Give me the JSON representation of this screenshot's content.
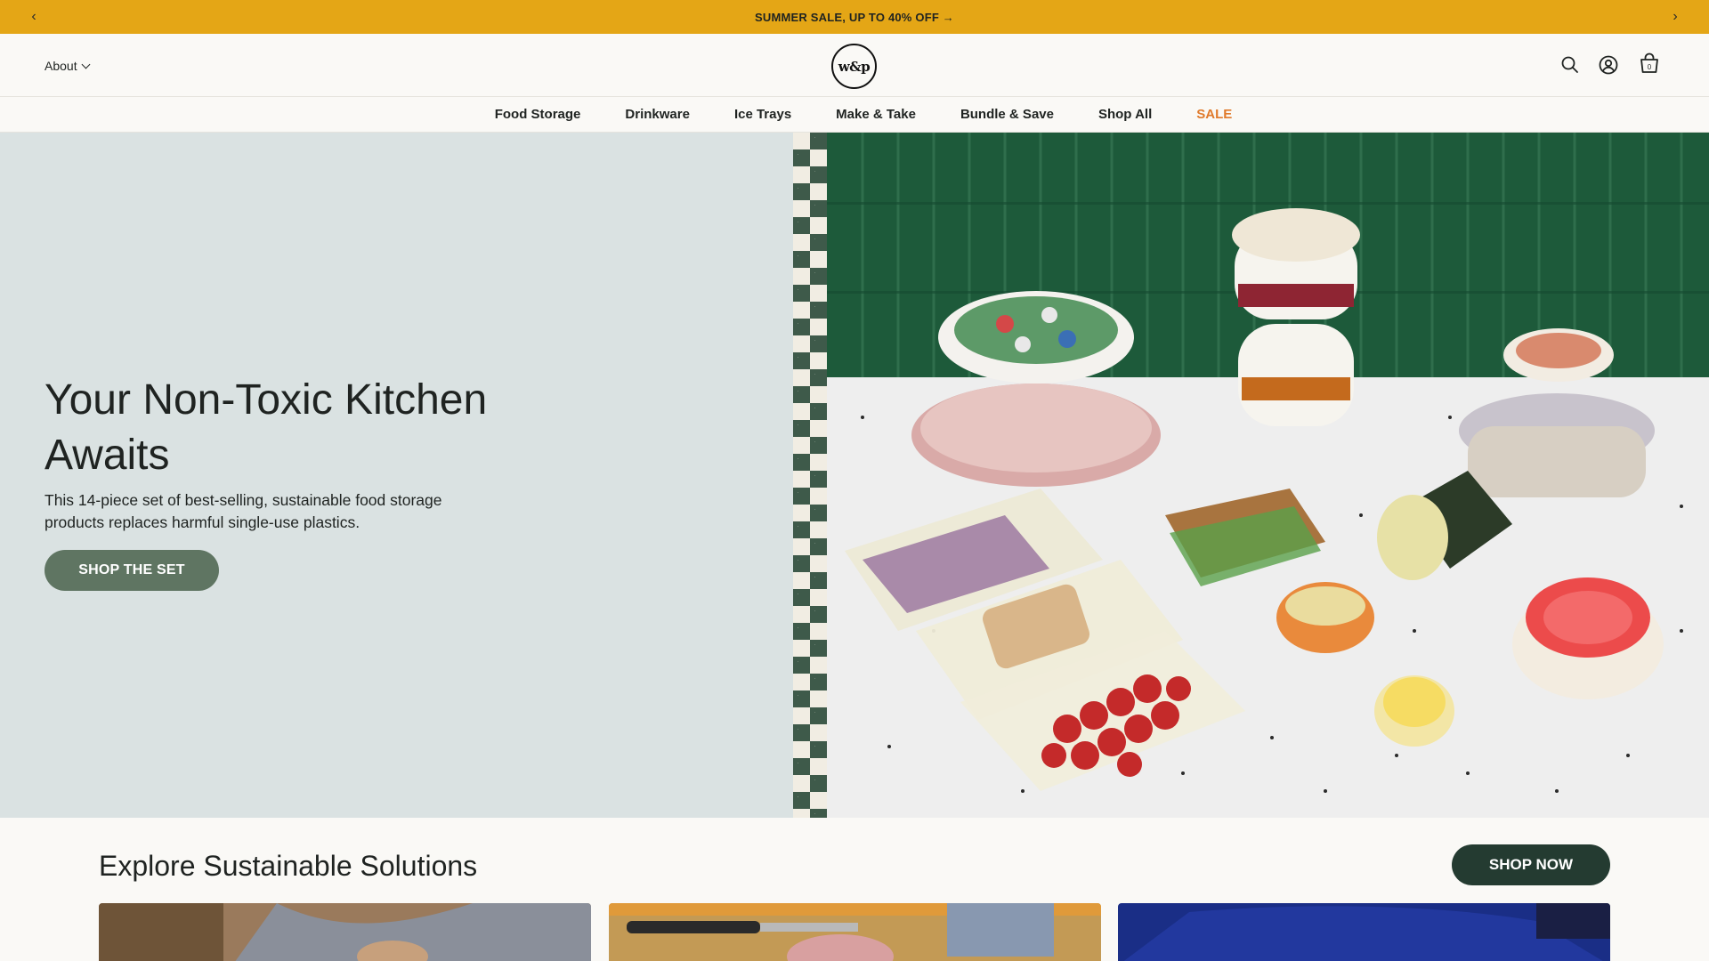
{
  "announcement": {
    "text": "SUMMER SALE, UP TO 40% OFF →",
    "prev_icon": "chevron-left-icon",
    "next_icon": "chevron-right-icon",
    "prev_glyph": "‹",
    "next_glyph": "›"
  },
  "header": {
    "about_label": "About",
    "logo_text": "w&p",
    "cart_count": "0",
    "icons": [
      "search-icon",
      "account-icon",
      "cart-icon"
    ]
  },
  "nav": {
    "items": [
      "Food Storage",
      "Drinkware",
      "Ice Trays",
      "Make & Take",
      "Bundle & Save",
      "Shop All",
      "SALE"
    ]
  },
  "hero": {
    "title": "Your Non-Toxic Kitchen Awaits",
    "subtitle": "This 14-piece set of best-selling, sustainable food storage products replaces harmful single-use plastics.",
    "button_label": "SHOP THE SET",
    "image_alt_icon": "food-storage-photo"
  },
  "explore": {
    "title": "Explore Sustainable Solutions",
    "button_label": "SHOP NOW",
    "cards": [
      "card-kitchen-wood",
      "card-cutting-board",
      "card-blue-sweater"
    ]
  },
  "colors": {
    "announcement_bg": "#e4a616",
    "hero_left_bg": "#dae2e2",
    "hero_button_bg": "#5f7562",
    "shop_now_bg": "#243b31",
    "sale_accent": "#e07a2b"
  }
}
